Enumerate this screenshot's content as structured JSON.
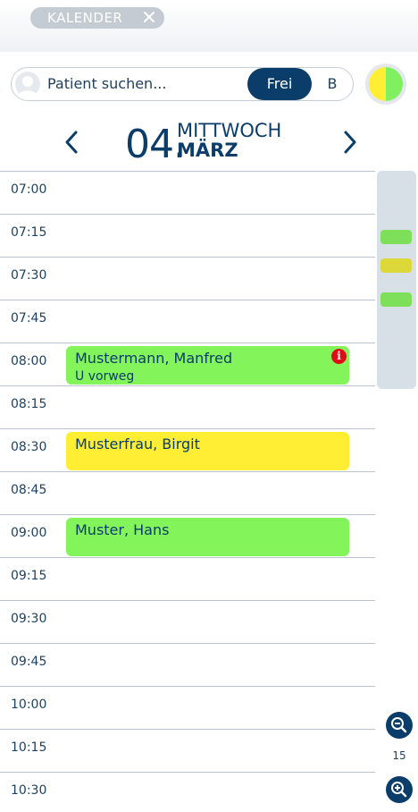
{
  "tab": {
    "label": "KALENDER",
    "close_icon": "close-icon"
  },
  "search": {
    "placeholder": "Patient suchen...",
    "avatar_icon": "person-icon"
  },
  "toggle": {
    "active": "Frei",
    "inactive": "B",
    "active_color": "#0b3d6b"
  },
  "status_indicator": {
    "left_color": "#ffee33",
    "right_color": "#80f060"
  },
  "date": {
    "day": "04.",
    "weekday": "MITTWOCH",
    "month": "MÄRZ"
  },
  "times": [
    "07:00",
    "07:15",
    "07:30",
    "07:45",
    "08:00",
    "08:15",
    "08:30",
    "08:45",
    "09:00",
    "09:15",
    "09:30",
    "09:45",
    "10:00",
    "10:15",
    "10:30"
  ],
  "appointments": [
    {
      "name": "Mustermann, Manfred",
      "note": "U vorweg",
      "start": "08:00",
      "color": "#83f55a",
      "has_info": true,
      "info_label": "i"
    },
    {
      "name": "Musterfrau, Birgit",
      "note": "",
      "start": "08:30",
      "color": "#ffee33",
      "has_info": false
    },
    {
      "name": "Muster, Hans",
      "note": "",
      "start": "09:00",
      "color": "#83f55a",
      "has_info": false
    }
  ],
  "overview_marks": [
    {
      "color": "#7ee05a"
    },
    {
      "color": "#dcd83a"
    },
    {
      "color": "#7ee05a"
    }
  ],
  "zoom": {
    "value": "15",
    "zoom_out_icon": "zoom-out-icon",
    "zoom_in_icon": "zoom-in-icon"
  }
}
